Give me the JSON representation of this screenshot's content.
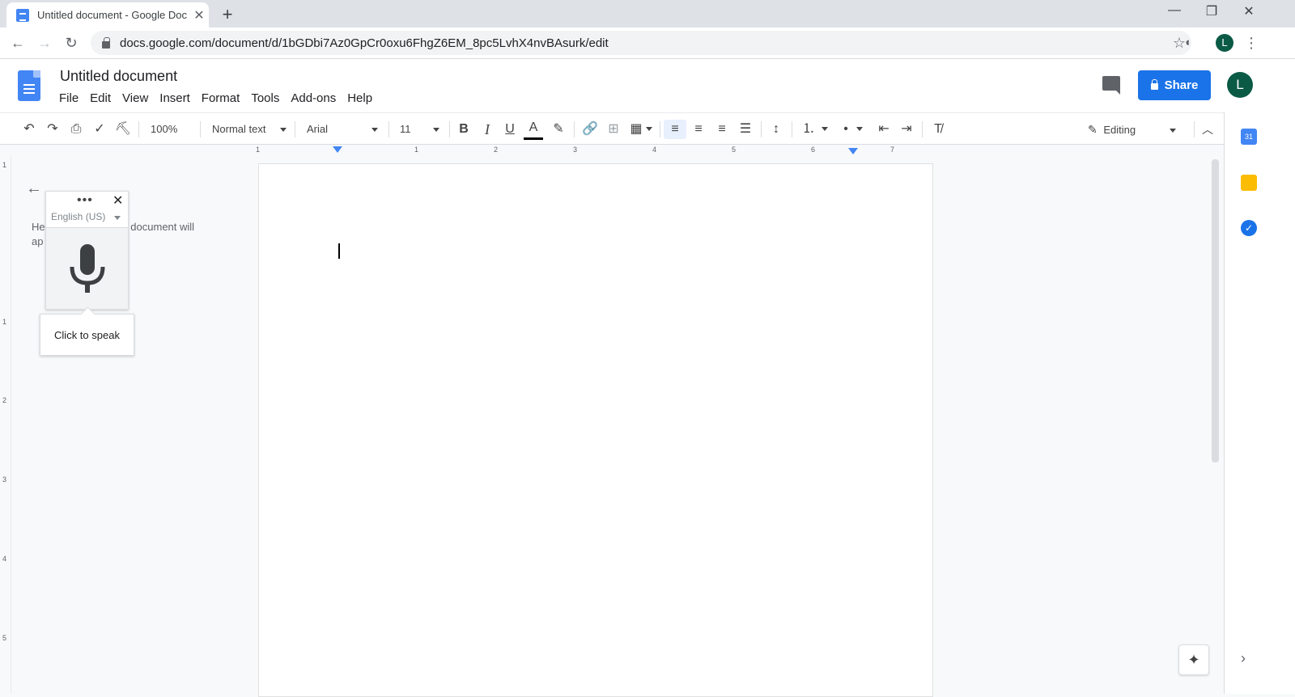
{
  "browser": {
    "tab_title": "Untitled document - Google Doc",
    "new_tab": "+",
    "url": "docs.google.com/document/d/1bGDbi7Az0GpCr0oxu6FhgZ6EM_8pc5LvhX4nvBAsurk/edit",
    "profile_initial": "L"
  },
  "docs": {
    "title": "Untitled document",
    "menu": [
      "File",
      "Edit",
      "View",
      "Insert",
      "Format",
      "Tools",
      "Add-ons",
      "Help"
    ],
    "share_label": "Share",
    "user_initial": "L"
  },
  "toolbar": {
    "zoom": "100%",
    "style": "Normal text",
    "font": "Arial",
    "size": "11",
    "bold": "B",
    "italic": "I",
    "underline": "U",
    "text_color": "A",
    "mode": "Editing"
  },
  "ruler": {
    "h_marks": [
      "1",
      "1",
      "2",
      "3",
      "4",
      "5",
      "6",
      "7"
    ],
    "v_marks": [
      "1",
      "1",
      "2",
      "3",
      "4",
      "5"
    ]
  },
  "outline": {
    "text_left": "He",
    "text_right": "the document will",
    "text_line2": "ap"
  },
  "voice": {
    "language": "English (US)",
    "tooltip": "Click to speak"
  },
  "colors": {
    "accent": "#1a73e8",
    "avatar": "#0b5a46",
    "docs_blue": "#4285f4"
  }
}
